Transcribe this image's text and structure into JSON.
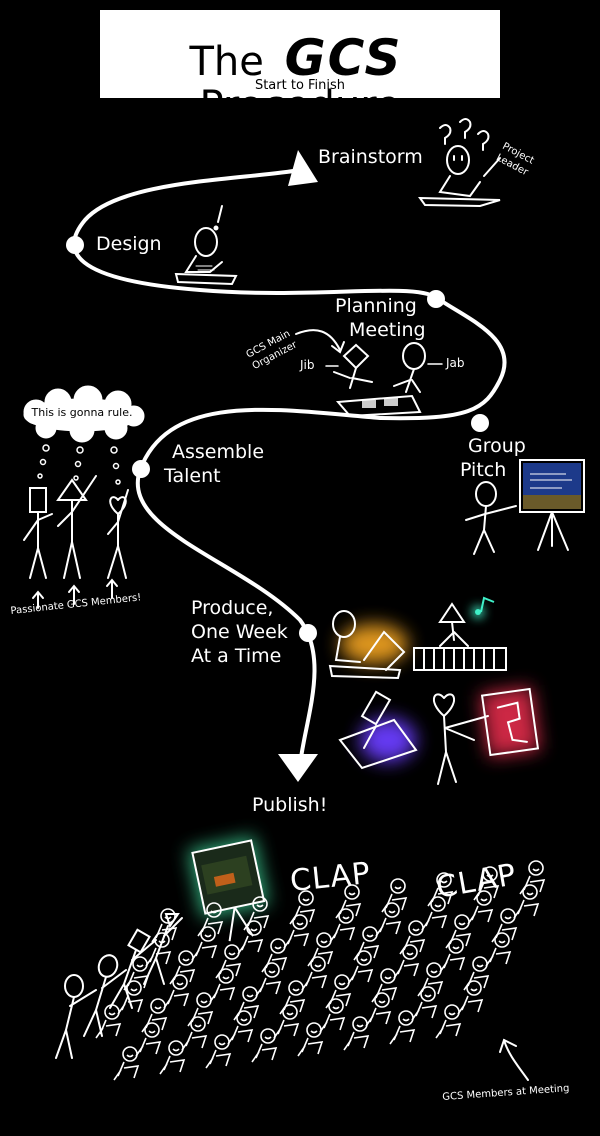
{
  "title": {
    "prefix": "The",
    "brand": "GCS",
    "suffix": "Procedure",
    "subtitle": "Start to Finish"
  },
  "stages": [
    {
      "id": "brainstorm",
      "label": "Brainstorm"
    },
    {
      "id": "design",
      "label": "Design"
    },
    {
      "id": "planning",
      "line1": "Planning",
      "line2": "Meeting"
    },
    {
      "id": "pitch",
      "line1": "Group",
      "line2": "Pitch"
    },
    {
      "id": "assemble",
      "line1": "Assemble",
      "line2": "Talent"
    },
    {
      "id": "produce",
      "line1": "Produce,",
      "line2": "One Week",
      "line3": "At a Time"
    },
    {
      "id": "publish",
      "label": "Publish!"
    }
  ],
  "annotations": {
    "project_leader_1": "Project",
    "project_leader_2": "Leader",
    "organizer_1": "GCS Main",
    "organizer_2": "Organizer",
    "jib": "Jib",
    "jab": "Jab",
    "thought": "This is gonna rule.",
    "members": "Passionate GCS Members!",
    "meeting_members": "GCS Members at Meeting",
    "clap": "CLAP"
  },
  "colors": {
    "background": "#000000",
    "line": "#ffffff",
    "glow_orange": "#f5a623",
    "glow_purple": "#6a3cff",
    "glow_red": "#ff3355",
    "glow_cyan": "#3ff0c8",
    "glow_green": "#40e0a0"
  }
}
